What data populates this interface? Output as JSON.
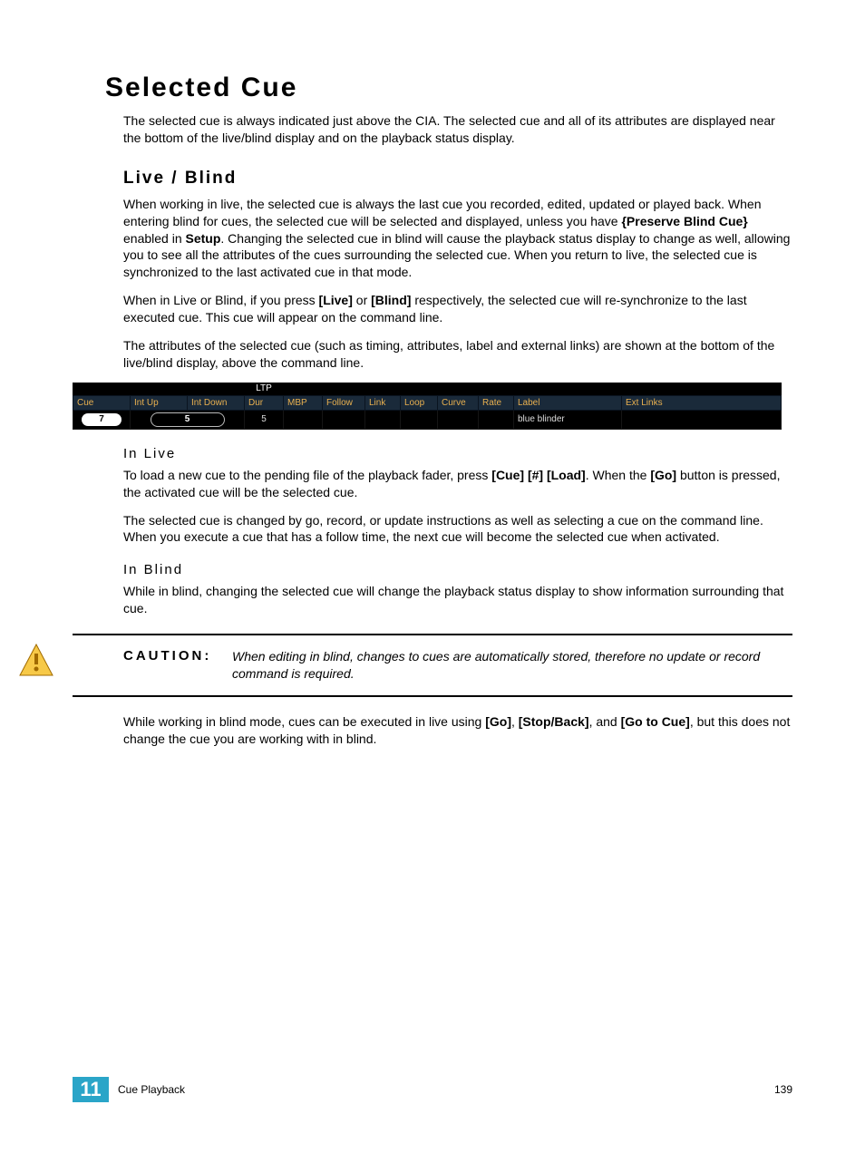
{
  "heading": "Selected Cue",
  "intro": "The selected cue is always indicated just above the CIA. The selected cue and all of its attributes are displayed near the bottom of the live/blind display and on the playback status display.",
  "section_live_blind": {
    "title": "Live / Blind",
    "p1_a": "When working in live, the selected cue is always the last cue you recorded, edited, updated or played back. When entering blind for cues, the selected cue will be selected and displayed, unless you have ",
    "p1_b": "{Preserve Blind Cue}",
    "p1_c": " enabled in ",
    "p1_d": "Setup",
    "p1_e": ". Changing the selected cue in blind will cause the playback status display to change as well, allowing you to see all the attributes of the cues surrounding the selected cue. When you return to live, the selected cue is synchronized to the last activated cue in that mode.",
    "p2_a": "When in Live or Blind, if you press ",
    "p2_b": "[Live]",
    "p2_c": " or ",
    "p2_d": "[Blind]",
    "p2_e": " respectively, the selected cue will re-synchronize to the last executed cue. This cue will appear on the command line.",
    "p3": "The attributes of the selected cue (such as timing, attributes, label and external links) are shown at the bottom of the live/blind display, above the command line."
  },
  "cue_bar": {
    "ltp": "LTP",
    "headers": [
      "Cue",
      "Int Up",
      "Int Down",
      "Dur",
      "MBP",
      "Follow",
      "Link",
      "Loop",
      "Curve",
      "Rate",
      "Label",
      "Ext Links"
    ],
    "row": {
      "cue": "7",
      "int": "5",
      "dur": "5",
      "mbp": "",
      "follow": "",
      "link": "",
      "loop": "",
      "curve": "",
      "rate": "",
      "label": "blue blinder",
      "ext": ""
    }
  },
  "in_live": {
    "title": "In Live",
    "p1_a": "To load a new cue to the pending file of the playback fader, press ",
    "p1_b": "[Cue] [#] [Load]",
    "p1_c": ". When the ",
    "p1_d": "[Go]",
    "p1_e": " button is pressed, the activated cue will be the selected cue.",
    "p2": "The selected cue is changed by go, record, or update instructions as well as selecting a cue on the command line. When you execute a cue that has a follow time, the next cue will become the selected cue when activated."
  },
  "in_blind": {
    "title": "In Blind",
    "p1": "While in blind, changing the selected cue will change the playback status display to show information surrounding that cue."
  },
  "caution": {
    "label": "CAUTION:",
    "text": "When editing in blind, changes to cues are automatically stored, therefore no update or record command is required."
  },
  "after_caution_a": "While working in blind mode, cues can be executed in live using ",
  "after_caution_b": "[Go]",
  "after_caution_c": ", ",
  "after_caution_d": "[Stop/Back]",
  "after_caution_e": ", and ",
  "after_caution_f": "[Go to Cue]",
  "after_caution_g": ", but this does not change the cue you are working with in blind.",
  "footer": {
    "chapter": "11",
    "title": "Cue Playback",
    "page": "139"
  }
}
